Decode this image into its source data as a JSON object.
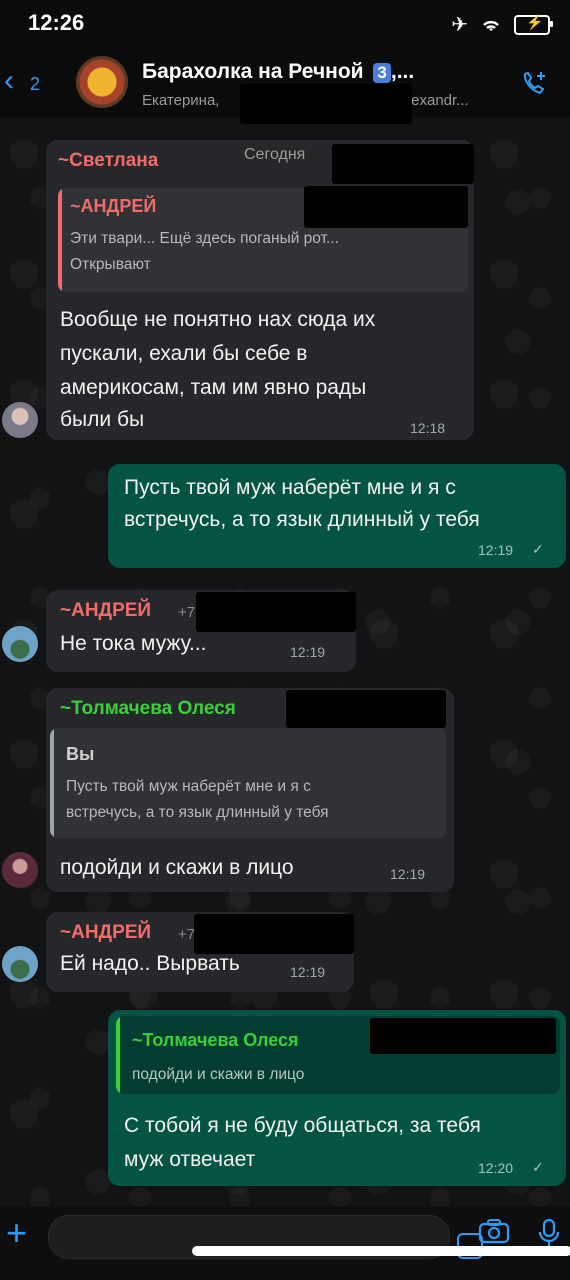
{
  "status": {
    "time": "12:26"
  },
  "header": {
    "back_count": "2",
    "group_name": "Барахолка на Речной",
    "badge": "3",
    "ellipsis": ",...",
    "members_left": "Екатерина,",
    "members_right": "Alexandr..."
  },
  "date_chip": "Сегодня",
  "messages": [
    {
      "sender": "~Светлана",
      "sender_color": "#f06b6b",
      "quote_sender": "~АНДРЕЙ",
      "quote_sender_color": "#f06b6b",
      "quote_text_1": "Эти твари... Ещё здесь поганый рот...",
      "quote_text_2": "Открывают",
      "text_1": "Вообще не понятно нах сюда их",
      "text_2": "пускали, ехали бы себе в",
      "text_3": "америкосам, там им явно рады",
      "text_4": "были бы",
      "time": "12:18"
    },
    {
      "text_1": "Пусть твой муж наберёт мне и я с",
      "text_2": "встречусь, а то язык длинный у тебя",
      "time": "12:19",
      "check": "✓"
    },
    {
      "sender": "~АНДРЕЙ",
      "sender_color": "#f06b6b",
      "phone_prefix": "+7",
      "text": "Не тока мужу...",
      "time": "12:19"
    },
    {
      "sender": "~Толмачева Олеся",
      "sender_color": "#3ccf3c",
      "quote_sender": "Вы",
      "quote_text_1": "Пусть твой муж наберёт мне и я с",
      "quote_text_2": "встречусь, а то язык длинный у тебя",
      "text": "подойди и скажи в лицо",
      "time": "12:19"
    },
    {
      "sender": "~АНДРЕЙ",
      "sender_color": "#f06b6b",
      "phone_prefix": "+7",
      "text": "Ей надо.. Вырвать",
      "time": "12:19"
    },
    {
      "quote_sender": "~Толмачева Олеся",
      "quote_sender_color": "#3ccf3c",
      "quote_text": "подойди и скажи в лицо",
      "text_1": "С тобой я не буду общаться, за тебя",
      "text_2": "муж отвечает",
      "time": "12:20",
      "check": "✓"
    }
  ],
  "icons": {
    "back": "chevron-left-icon",
    "call": "add-call-icon",
    "plus": "plus-icon",
    "sticker": "sticker-icon",
    "camera": "camera-icon",
    "mic": "microphone-icon"
  }
}
